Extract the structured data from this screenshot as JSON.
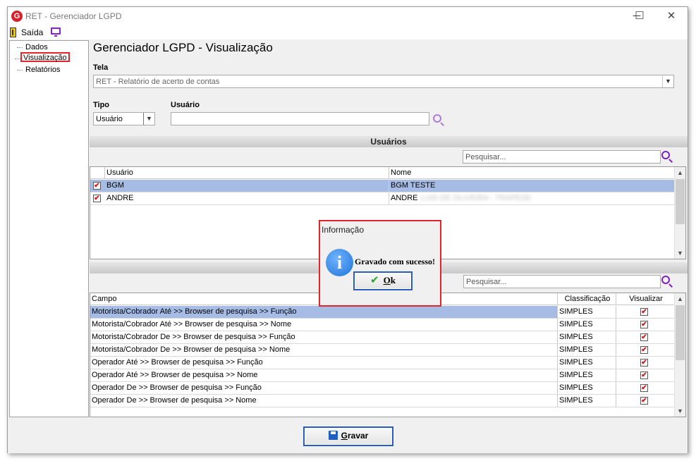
{
  "window": {
    "title": "RET - Gerenciador LGPD",
    "logo_letter": "G"
  },
  "title_buttons": {
    "minimize": "─",
    "maximize": "☐",
    "close": "✕"
  },
  "menu": {
    "exit_label": "Saída"
  },
  "tree": {
    "items": [
      {
        "label": "Dados",
        "selected": false
      },
      {
        "label": "Visualização",
        "selected": true
      },
      {
        "label": "Relatórios",
        "selected": false
      }
    ]
  },
  "page_title": "Gerenciador LGPD - Visualização",
  "tela": {
    "label": "Tela",
    "value": "RET - Relatório de acerto de contas"
  },
  "tipo": {
    "label": "Tipo",
    "value": "Usuário"
  },
  "usuario_filter": {
    "label": "Usuário",
    "value": ""
  },
  "users_section": {
    "title": "Usuários",
    "search_placeholder": "Pesquisar...",
    "columns": [
      "Usuário",
      "Nome"
    ],
    "rows": [
      {
        "checked": true,
        "user": "BGM",
        "name": "BGM TESTE",
        "name_hidden": "",
        "selected": true
      },
      {
        "checked": true,
        "user": "ANDRE",
        "name": "ANDRE",
        "name_hidden": "LUIS DE OLIVEIRA - TRAPESE",
        "selected": false
      }
    ]
  },
  "fields_section": {
    "search_placeholder": "Pesquisar...",
    "columns": [
      "Campo",
      "Classificação",
      "Visualizar"
    ],
    "rows": [
      {
        "campo": "Motorista/Cobrador Até >> Browser de pesquisa >> Função",
        "classificacao": "SIMPLES",
        "visualizar": true,
        "selected": true
      },
      {
        "campo": "Motorista/Cobrador Até >> Browser de pesquisa >> Nome",
        "classificacao": "SIMPLES",
        "visualizar": true,
        "selected": false
      },
      {
        "campo": "Motorista/Cobrador De >> Browser de pesquisa >> Função",
        "classificacao": "SIMPLES",
        "visualizar": true,
        "selected": false
      },
      {
        "campo": "Motorista/Cobrador De >> Browser de pesquisa >> Nome",
        "classificacao": "SIMPLES",
        "visualizar": true,
        "selected": false
      },
      {
        "campo": "Operador Até >> Browser de pesquisa >> Função",
        "classificacao": "SIMPLES",
        "visualizar": true,
        "selected": false
      },
      {
        "campo": "Operador Até >> Browser de pesquisa >> Nome",
        "classificacao": "SIMPLES",
        "visualizar": true,
        "selected": false
      },
      {
        "campo": "Operador De >> Browser de pesquisa >> Função",
        "classificacao": "SIMPLES",
        "visualizar": true,
        "selected": false
      },
      {
        "campo": "Operador De >> Browser de pesquisa >> Nome",
        "classificacao": "SIMPLES",
        "visualizar": true,
        "selected": false
      }
    ]
  },
  "save_button": {
    "label_mnemonic": "G",
    "label_rest": "ravar"
  },
  "dialog": {
    "title": "Informação",
    "message": "Gravado com sucesso!",
    "ok_mnemonic": "O",
    "ok_rest": "k",
    "icon_glyph": "i",
    "ok_check": "✔"
  },
  "colors": {
    "selection": "#a7bce4",
    "highlight_border": "#e3242b",
    "button_border": "#2a5cbe",
    "accent_purple": "#7b1fc9"
  }
}
